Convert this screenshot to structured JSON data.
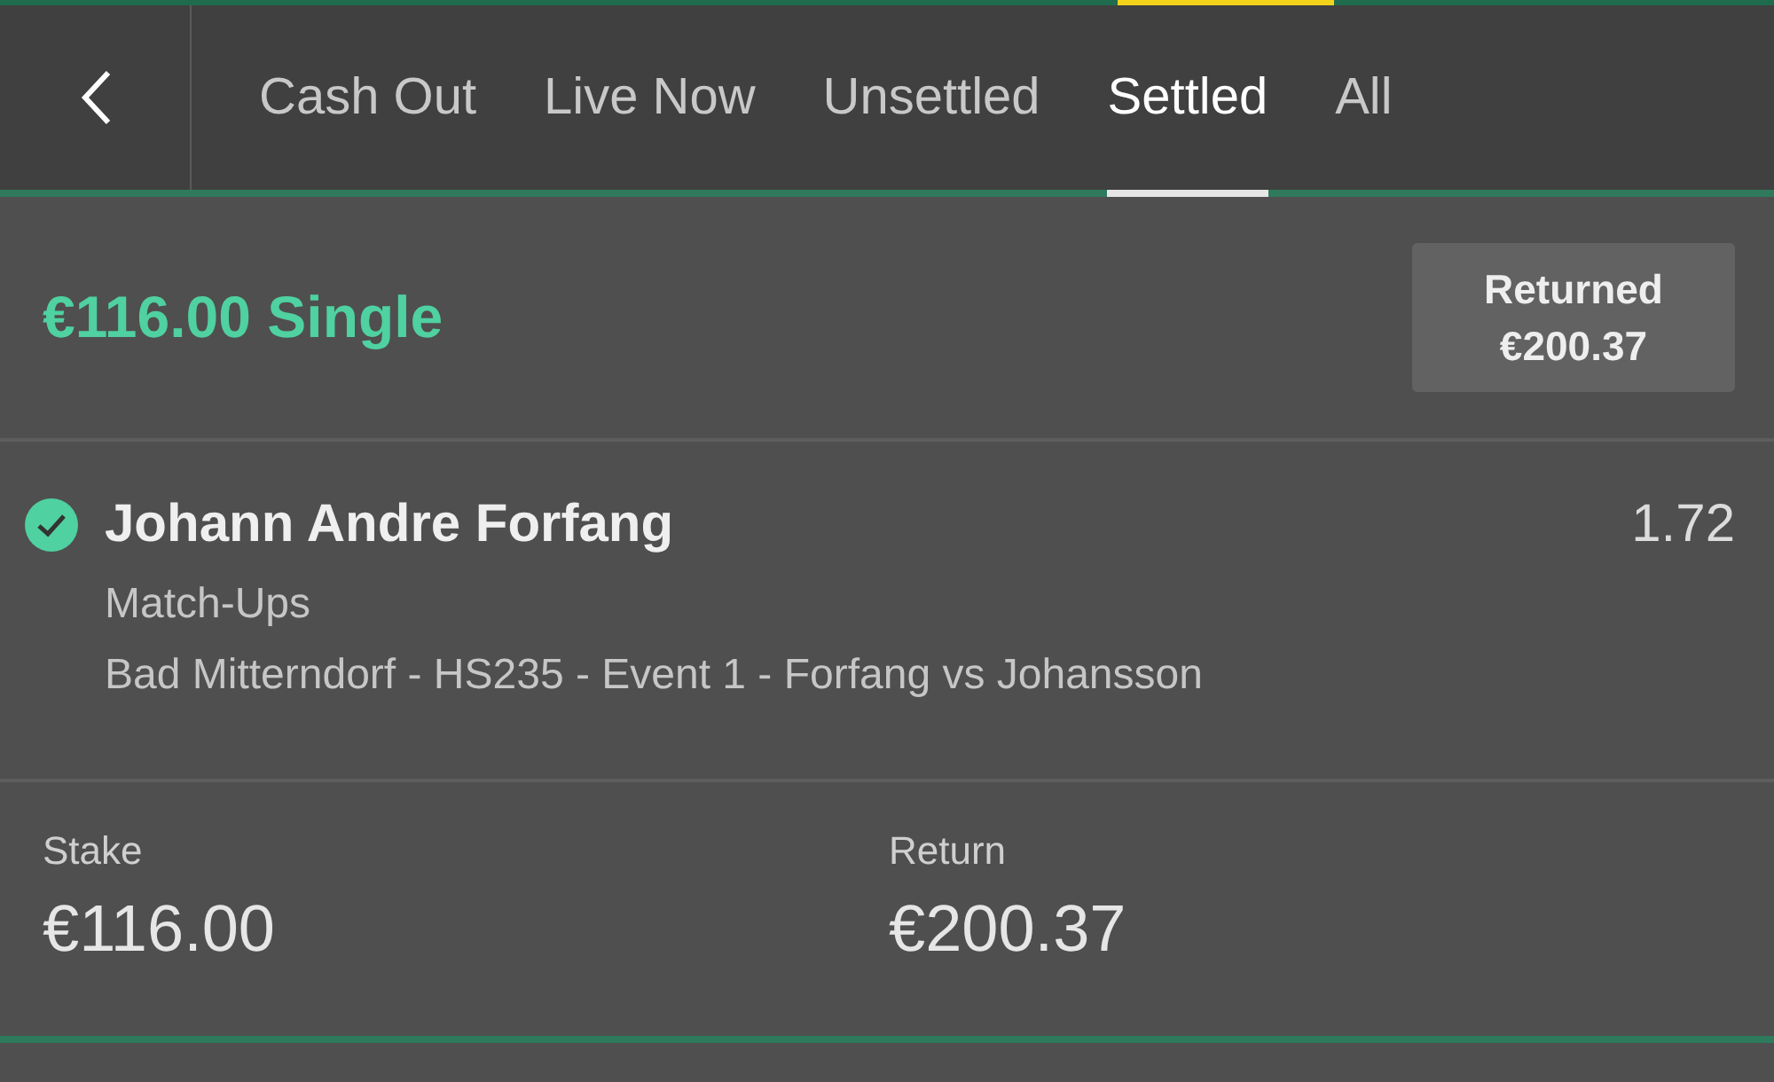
{
  "tabs": [
    {
      "label": "Cash Out",
      "selected": false
    },
    {
      "label": "Live Now",
      "selected": false
    },
    {
      "label": "Unsettled",
      "selected": false
    },
    {
      "label": "Settled",
      "selected": true
    },
    {
      "label": "All",
      "selected": false
    }
  ],
  "bet": {
    "title": "€116.00 Single",
    "returned_label": "Returned",
    "returned_value": "€200.37",
    "selection": {
      "name": "Johann Andre Forfang",
      "won": true,
      "odds": "1.72",
      "market": "Match-Ups",
      "event": "Bad Mitterndorf - HS235 - Event 1 - Forfang vs Johansson"
    },
    "summary": [
      {
        "label": "Stake",
        "value": "€116.00"
      },
      {
        "label": "Return",
        "value": "€200.37"
      }
    ]
  }
}
